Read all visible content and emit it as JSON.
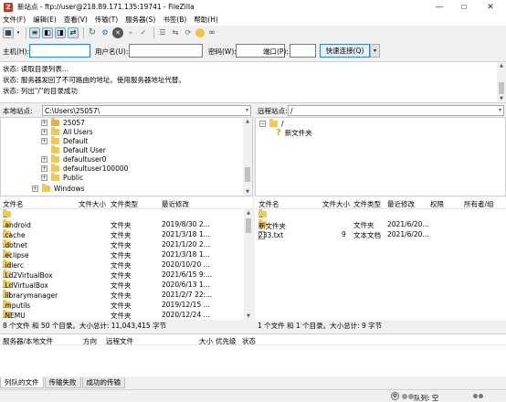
{
  "window": {
    "title": "新站点 - ftp://user@218.89.171.135:19741 - FileZilla",
    "icon": "filezilla-icon",
    "controls": [
      "—",
      "☐",
      "✕"
    ]
  },
  "menu": [
    "文件(F)",
    "编辑(E)",
    "查看(V)",
    "传输(T)",
    "服务器(S)",
    "书签(B)",
    "帮助(H)"
  ],
  "quickconnect": {
    "host_label": "主机(H):",
    "host_value": "",
    "user_label": "用户名(U):",
    "user_value": "",
    "pass_label": "密码(W):",
    "pass_value": "",
    "port_label": "端口(P):",
    "port_value": "",
    "button": "快速连接(Q)",
    "dropdown": "▾"
  },
  "log": [
    "状态:  读取目录列表...",
    "状态:  服务器发回了不可路由的地址。使用服务器地址代替。",
    "状态:  列出\"/\"的目录成功"
  ],
  "local": {
    "site_label": "本地站点:",
    "path": "C:\\Users\\25057\\",
    "tree": [
      {
        "label": "25057",
        "indent": 3,
        "expander": "+",
        "icon": "user-folder"
      },
      {
        "label": "All Users",
        "indent": 3,
        "expander": "+",
        "icon": "folder"
      },
      {
        "label": "Default",
        "indent": 3,
        "expander": "+",
        "icon": "folder"
      },
      {
        "label": "Default User",
        "indent": 3,
        "expander": "",
        "icon": "folder"
      },
      {
        "label": "defaultuser0",
        "indent": 3,
        "expander": "+",
        "icon": "folder"
      },
      {
        "label": "defaultuser100000",
        "indent": 3,
        "expander": "+",
        "icon": "folder"
      },
      {
        "label": "Public",
        "indent": 3,
        "expander": "+",
        "icon": "folder"
      },
      {
        "label": "Windows",
        "indent": 2,
        "expander": "+",
        "icon": "folder"
      }
    ],
    "columns": [
      "文件名",
      "文件大小",
      "文件类型",
      "最近修改"
    ],
    "files": [
      {
        "name": "..",
        "size": "",
        "type": "",
        "modified": ""
      },
      {
        "name": ".android",
        "size": "",
        "type": "文件夹",
        "modified": "2019/8/30 2..."
      },
      {
        "name": ".cache",
        "size": "",
        "type": "文件夹",
        "modified": "2021/3/18 1..."
      },
      {
        "name": ".dotnet",
        "size": "",
        "type": "文件夹",
        "modified": "2021/1/20 2..."
      },
      {
        "name": ".eclipse",
        "size": "",
        "type": "文件夹",
        "modified": "2021/3/18 1..."
      },
      {
        "name": ".idlerc",
        "size": "",
        "type": "文件夹",
        "modified": "2020/10/20 ..."
      },
      {
        "name": ".Ld2VirtualBox",
        "size": "",
        "type": "文件夹",
        "modified": "2021/6/15 9:..."
      },
      {
        "name": ".LdVirtualBox",
        "size": "",
        "type": "文件夹",
        "modified": "2020/6/13 1..."
      },
      {
        "name": ".librarymanager",
        "size": "",
        "type": "文件夹",
        "modified": "2021/2/7 22:..."
      },
      {
        "name": ".mputils",
        "size": "",
        "type": "文件夹",
        "modified": "2019/12/15 ..."
      },
      {
        "name": ".NEMU",
        "size": "",
        "type": "文件夹",
        "modified": "2020/12/24 ..."
      }
    ],
    "status": "8 个文件 和 50 个目录。大小总计: 11,043,415 字节"
  },
  "remote": {
    "site_label": "远程站点:",
    "path": "/",
    "tree": [
      {
        "label": "/",
        "indent": 0,
        "expander": "−",
        "icon": "folder"
      },
      {
        "label": "新文件夹",
        "indent": 1,
        "expander": "",
        "icon": "unknown-folder"
      }
    ],
    "columns": [
      "文件名",
      "文件大小",
      "文件类型",
      "最近修改",
      "权限",
      "所有者/组"
    ],
    "files": [
      {
        "name": "..",
        "size": "",
        "type": "",
        "modified": "",
        "icon": "folder"
      },
      {
        "name": "新文件夹",
        "size": "",
        "type": "文件夹",
        "modified": "2021/6/20...",
        "icon": "folder"
      },
      {
        "name": "233.txt",
        "size": "9",
        "type": "文本文档",
        "modified": "2021/6/20...",
        "icon": "file"
      }
    ],
    "status": "1 个文件 和 1 个目录。大小总计: 9 字节"
  },
  "queue": {
    "columns": [
      "服务器/本地文件",
      "方向",
      "远程文件",
      "大小",
      "优先级",
      "状态"
    ],
    "tabs": [
      "列队的文件",
      "传输失败",
      "成功的传输"
    ],
    "active_tab": 0,
    "status_text": "队列: 空"
  }
}
